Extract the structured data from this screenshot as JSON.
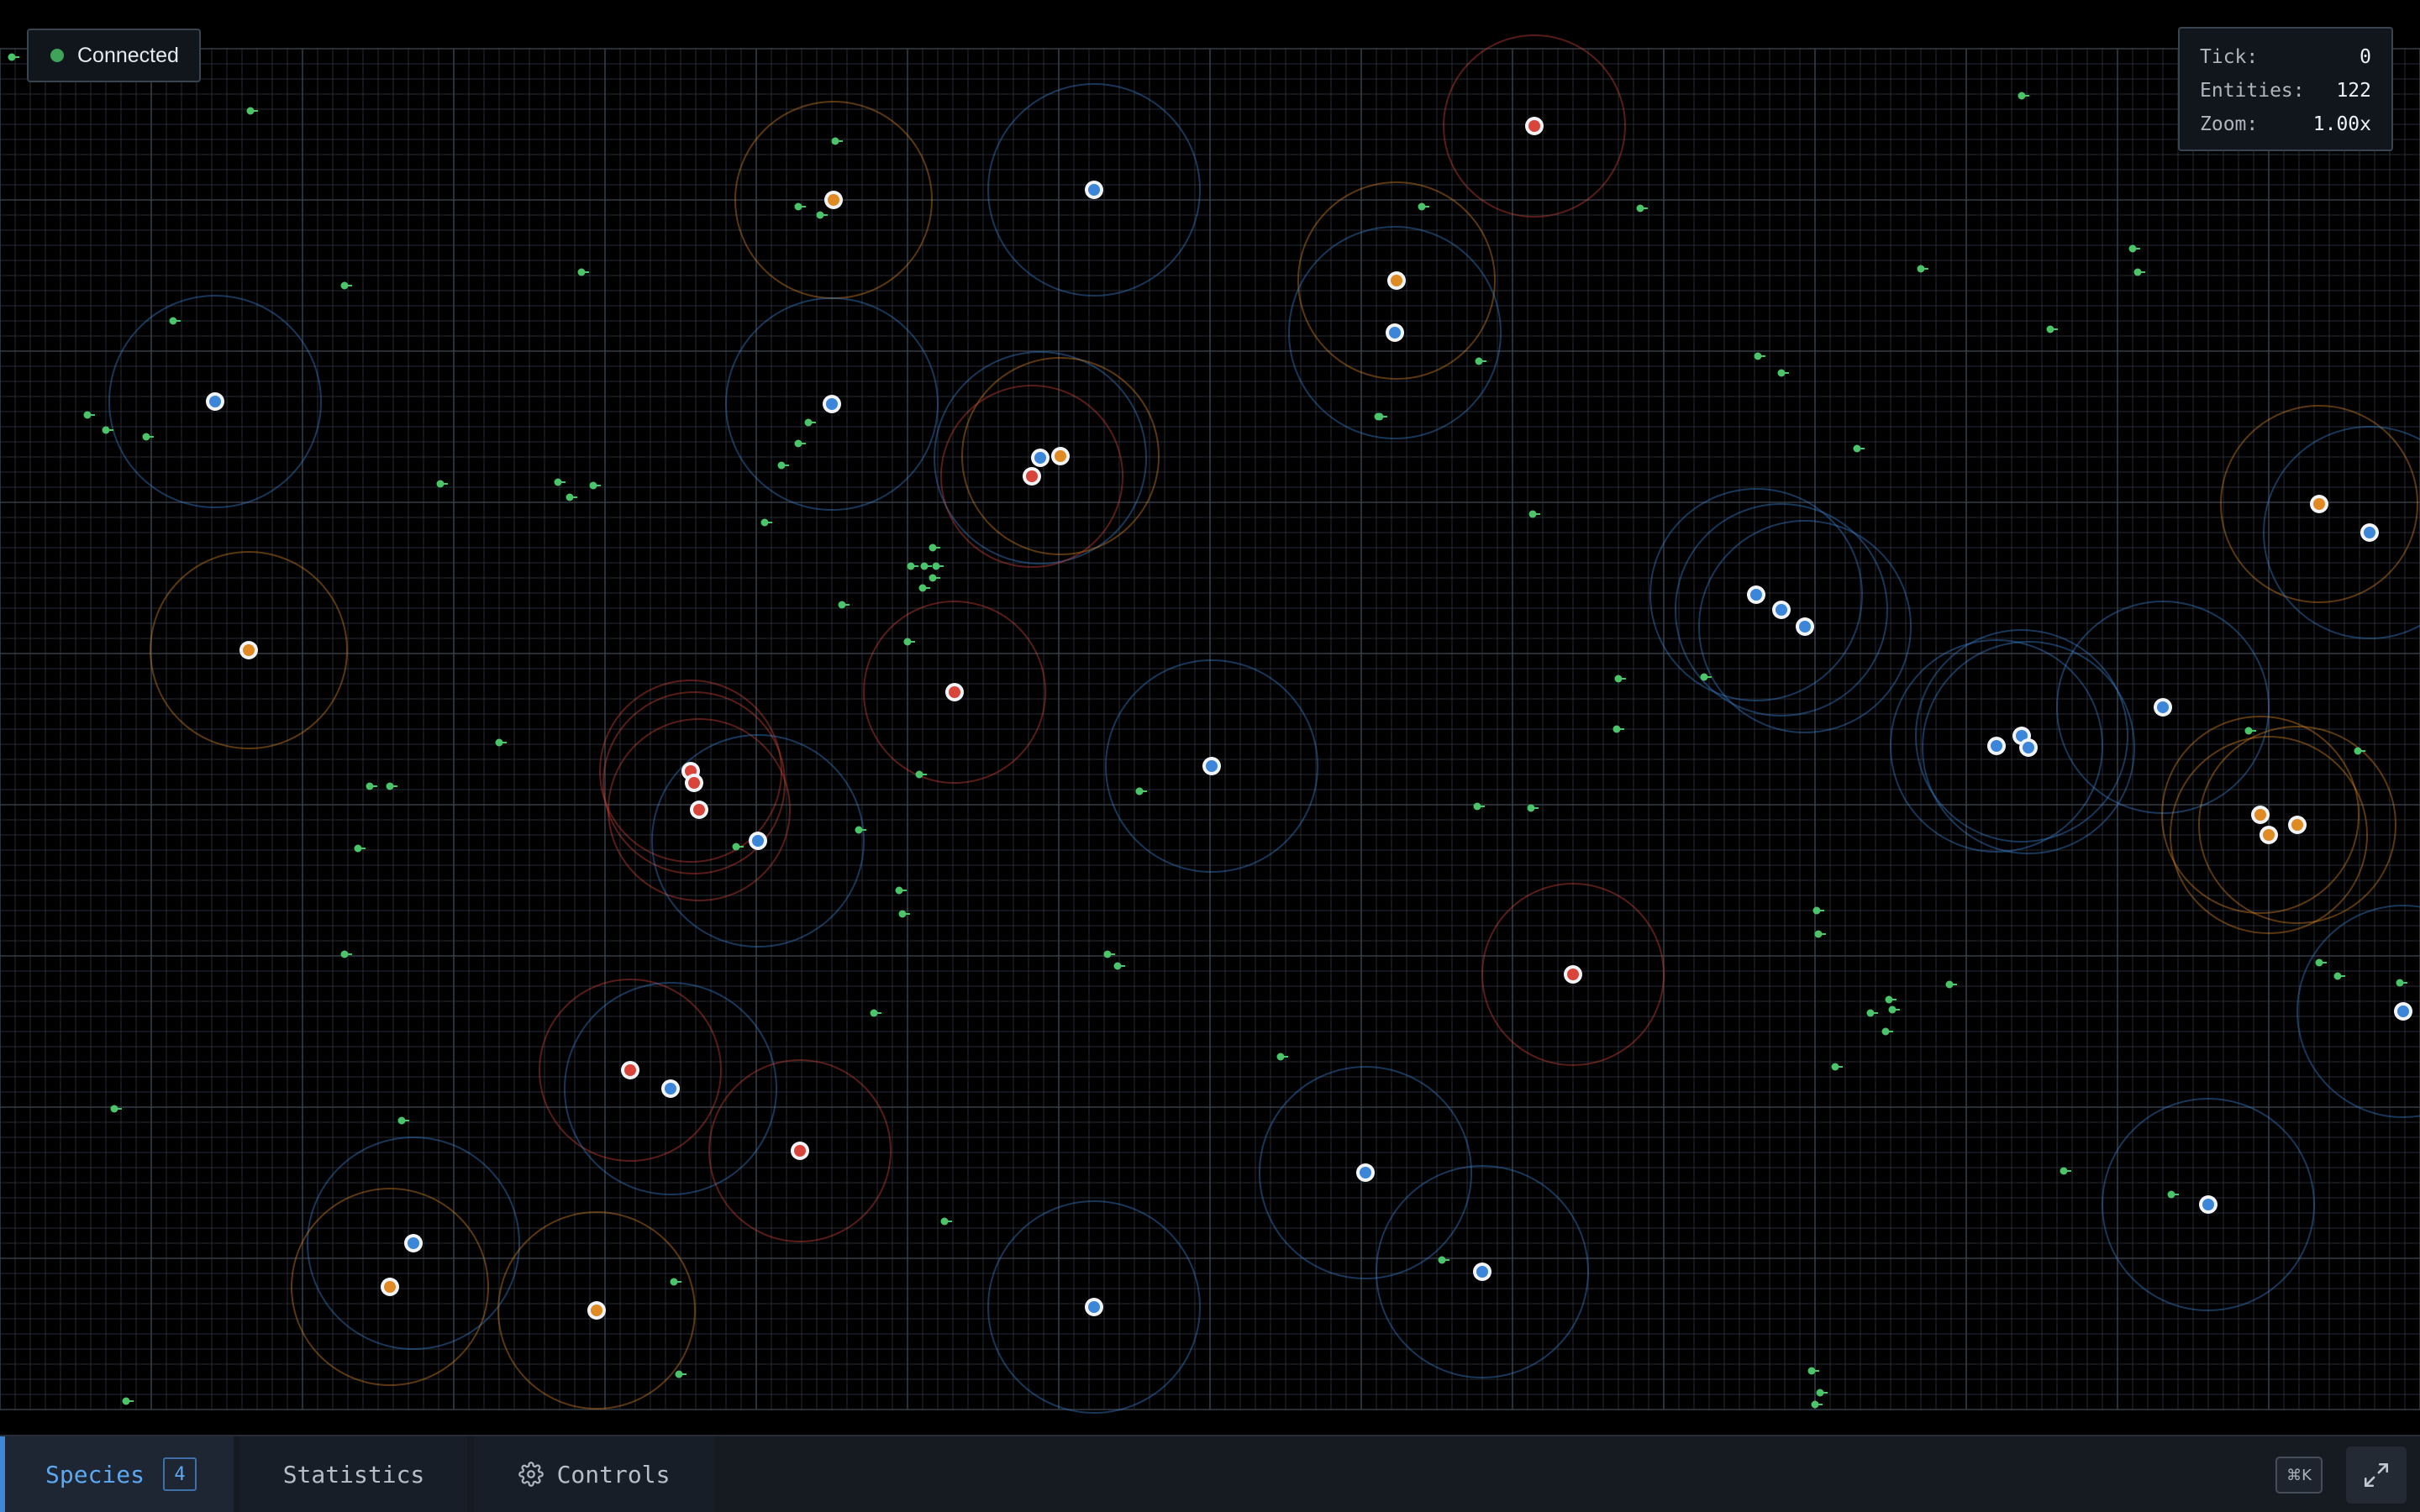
{
  "connection": {
    "status_label": "Connected",
    "status_color": "#3fa35a"
  },
  "stats": {
    "tick_label": "Tick:",
    "tick_value": "0",
    "entities_label": "Entities:",
    "entities_value": "122",
    "zoom_label": "Zoom:",
    "zoom_value": "1.00x"
  },
  "tabs": {
    "species_label": "Species",
    "species_count": "4",
    "statistics_label": "Statistics",
    "controls_label": "Controls"
  },
  "shortcut": {
    "label": "⌘K"
  },
  "icons": {
    "controls": "gear-icon",
    "expand": "expand-icon",
    "status": "status-dot"
  },
  "colors": {
    "grid": "#3c4654",
    "food": "#4cc46a",
    "species_blue": "#3b86d9",
    "species_orange": "#e08a24",
    "species_red": "#d9453a",
    "accent": "#3d87d6"
  }
}
